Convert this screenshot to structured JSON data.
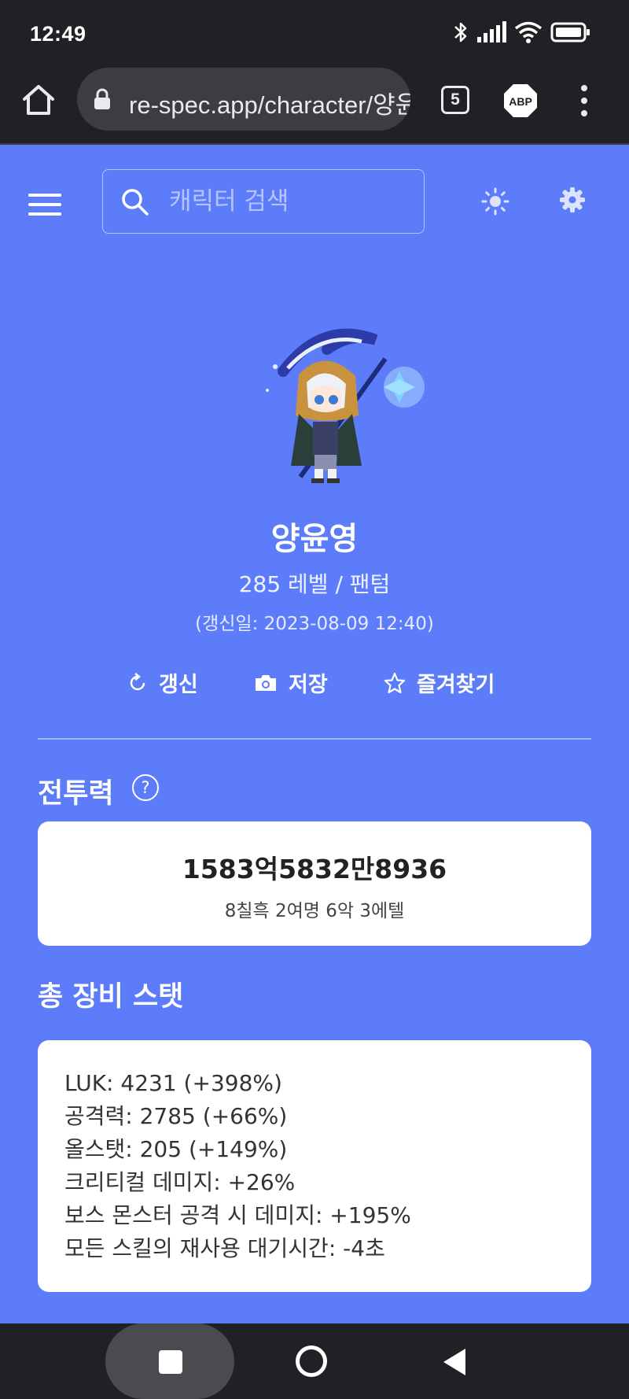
{
  "status_bar": {
    "time": "12:49"
  },
  "browser": {
    "url": "re-spec.app/character/양윤영",
    "tab_count": "5",
    "adblock_label": "ABP"
  },
  "header": {
    "search_placeholder": "캐릭터 검색"
  },
  "character": {
    "name": "양윤영",
    "level_job": "285 레벨 / 팬텀",
    "updated": "(갱신일: 2023-08-09 12:40)"
  },
  "actions": {
    "refresh": "갱신",
    "save": "저장",
    "favorite": "즐겨찾기"
  },
  "power": {
    "title": "전투력",
    "help": "?",
    "value": "1583억5832만8936",
    "tier": "8칠흑 2여명 6악 3에텔"
  },
  "stats": {
    "title": "총 장비 스탯",
    "lines": [
      "LUK: 4231 (+398%)",
      "공격력: 2785 (+66%)",
      "올스탯: 205 (+149%)",
      "크리티컬 데미지: +26%",
      "보스 몬스터 공격 시 데미지: +195%",
      "모든 스킬의 재사용 대기시간: -4초"
    ]
  },
  "colors": {
    "page_background": "#5c7cfa",
    "card_background": "#ffffff",
    "chrome": "#202124"
  },
  "icons": [
    "bluetooth-icon",
    "signal-icon",
    "wifi-icon",
    "battery-icon",
    "home-icon",
    "lock-icon",
    "menu-icon",
    "search-icon",
    "sun-icon",
    "gear-icon",
    "refresh-icon",
    "camera-icon",
    "star-icon",
    "help-icon"
  ]
}
